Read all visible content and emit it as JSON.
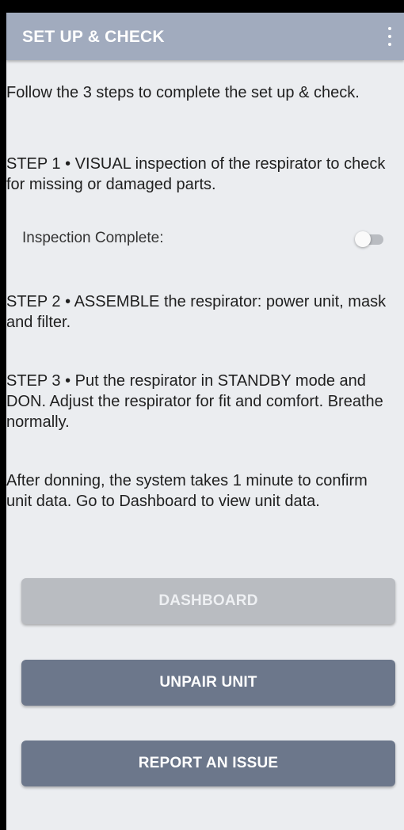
{
  "header": {
    "title": "SET UP & CHECK",
    "menu_icon": "more-vert-icon"
  },
  "intro": "Follow the 3 steps to complete the set up & check.",
  "steps": [
    "STEP 1 • VISUAL inspection of the respirator to check for missing or damaged parts.",
    "STEP 2 • ASSEMBLE the respirator: power unit, mask and filter.",
    "STEP 3 • Put the respirator in STANDBY mode and DON. Adjust the respirator for fit and comfort. Breathe normally."
  ],
  "inspection": {
    "label": "Inspection Complete:",
    "toggle_on": false
  },
  "after_note": "After donning, the system takes 1 minute to confirm unit data. Go to Dashboard to view unit data.",
  "buttons": {
    "dashboard": "DASHBOARD",
    "unpair": "UNPAIR UNIT",
    "report": "REPORT AN ISSUE"
  },
  "colors": {
    "app_bar": "#a1abbe",
    "background": "#ebedf0",
    "button_primary": "#6c778b",
    "button_disabled": "#b9bcc1"
  }
}
